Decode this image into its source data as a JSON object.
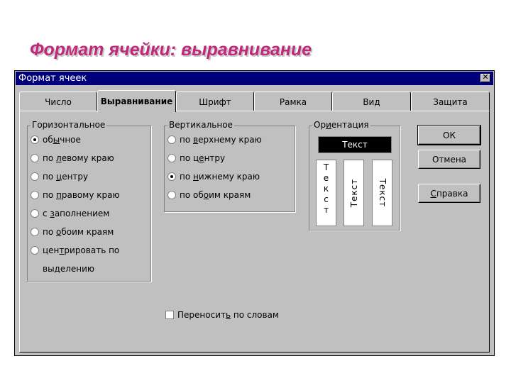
{
  "slide": {
    "title": "Формат ячейки:  выравнивание"
  },
  "dialog": {
    "title": "Формат ячеек",
    "close_symbol": "✕"
  },
  "tabs": [
    {
      "label": "Число",
      "active": false
    },
    {
      "label": "Выравнивание",
      "active": true
    },
    {
      "label": "Шрифт",
      "active": false
    },
    {
      "label": "Рамка",
      "active": false
    },
    {
      "label": "Вид",
      "active": false
    },
    {
      "label": "Защита",
      "active": false
    }
  ],
  "horizontal": {
    "label": "Горизонтальное",
    "options": [
      {
        "pre": "об",
        "u": "ы",
        "post": "чное",
        "checked": true
      },
      {
        "pre": "по ",
        "u": "л",
        "post": "евому краю",
        "checked": false
      },
      {
        "pre": "по ",
        "u": "ц",
        "post": "ентру",
        "checked": false
      },
      {
        "pre": "по ",
        "u": "п",
        "post": "равому краю",
        "checked": false
      },
      {
        "pre": "с ",
        "u": "з",
        "post": "аполнением",
        "checked": false
      },
      {
        "pre": "по ",
        "u": "о",
        "post": "боим краям",
        "checked": false
      },
      {
        "pre": "цен",
        "u": "т",
        "post": "рировать по",
        "checked": false
      }
    ],
    "last_option_line2": "выделению"
  },
  "vertical": {
    "label": "Вертикальное",
    "options": [
      {
        "pre": "по ",
        "u": "в",
        "post": "ерхнему краю",
        "checked": false
      },
      {
        "pre": "по ц",
        "u": "е",
        "post": "нтру",
        "checked": false
      },
      {
        "pre": "по ",
        "u": "н",
        "post": "ижнему краю",
        "checked": true
      },
      {
        "pre": "по об",
        "u": "о",
        "post": "им краям",
        "checked": false
      }
    ]
  },
  "wrap": {
    "pre": "Переносит",
    "u": "ь",
    "post": " по словам",
    "checked": false
  },
  "orientation": {
    "label_pre": "Ор",
    "label_u": "и",
    "label_post": "ентация",
    "sample_text": "Текст",
    "stacked_letters": [
      "Т",
      "е",
      "к",
      "с",
      "т"
    ]
  },
  "buttons": {
    "ok": "ОК",
    "cancel": "Отмена",
    "help_u": "С",
    "help_post": "правка"
  },
  "colors": {
    "title_color": "#c0287a",
    "titlebar": "#00007a",
    "dialog_face": "#c0c0c0"
  }
}
